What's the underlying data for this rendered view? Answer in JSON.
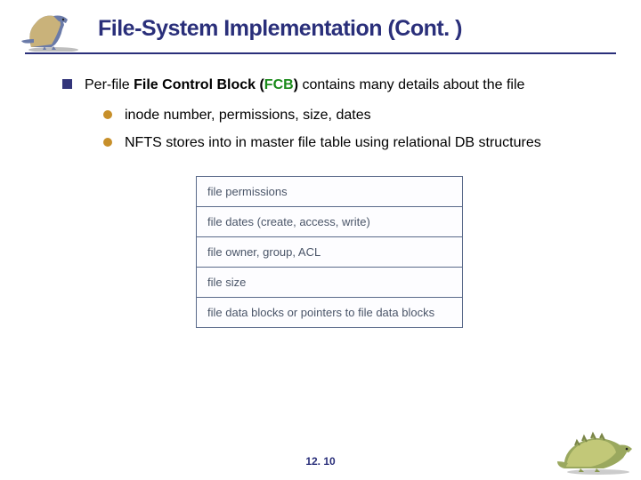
{
  "header": {
    "title": "File-System Implementation (Cont. )"
  },
  "main_bullet": {
    "prefix": "Per-file ",
    "bold1": "File Control Block (",
    "term": "FCB",
    "bold2": ")",
    "suffix": " contains many details about the file"
  },
  "sub_bullets": [
    "inode number, permissions, size, dates",
    "NFTS stores into in master file table  using relational DB structures"
  ],
  "fcb_rows": [
    "file permissions",
    "file dates (create, access, write)",
    "file owner, group, ACL",
    "file size",
    "file data blocks or pointers to file data blocks"
  ],
  "footer": {
    "page": "12. 10"
  }
}
